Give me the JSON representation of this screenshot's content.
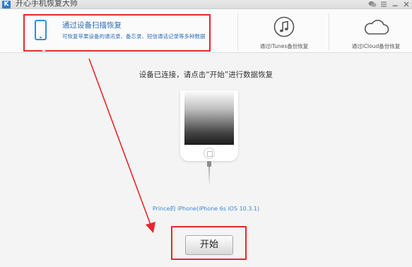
{
  "window": {
    "title": "开心手机恢复大师",
    "logo_letter": "K",
    "controls": [
      "wechat-icon",
      "menu-icon",
      "minimize-icon",
      "close-icon"
    ]
  },
  "nav": {
    "scan": {
      "title": "通过设备扫描恢复",
      "subtitle": "可恢复苹果设备的通讯录、备忘录、短信通话记录等多种数据",
      "icon": "phone-icon",
      "selected": true
    },
    "itunes": {
      "label": "通过iTunes备份恢复",
      "icon": "music-note-icon"
    },
    "icloud": {
      "label": "通过iCloud备份恢复",
      "icon": "cloud-icon"
    }
  },
  "main": {
    "status": "设备已连接，请点击“开始”进行数据恢复",
    "device_name": "Prince的 iPhone(iPhone 6s iOS 10.3.1)",
    "start_label": "开始"
  },
  "colors": {
    "accent_blue": "#2f8ee0",
    "highlight_red": "#e8272d",
    "link_blue": "#3a8ad6"
  }
}
